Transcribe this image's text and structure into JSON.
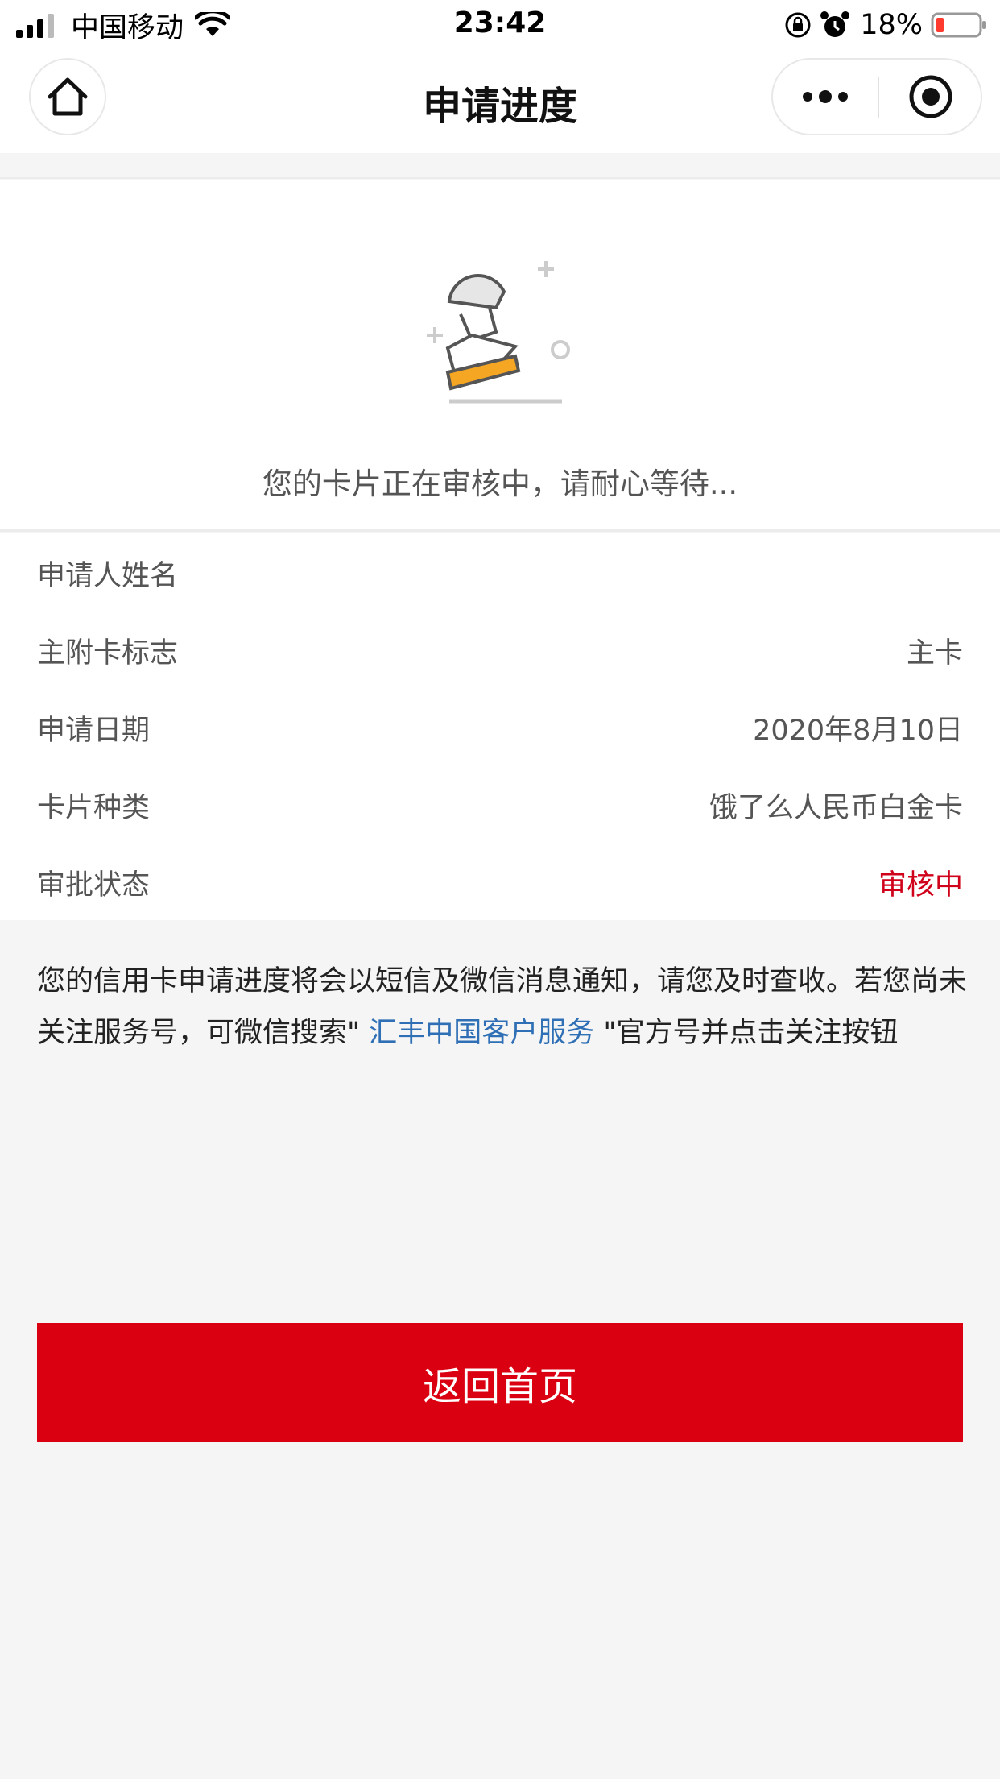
{
  "status_bar": {
    "carrier": "中国移动",
    "time": "23:42",
    "battery": "18%"
  },
  "nav": {
    "title": "申请进度",
    "home_icon": "home-icon",
    "more_icon": "more-dots-icon",
    "close_icon": "target-close-icon"
  },
  "status_card": {
    "icon": "stamp-icon",
    "message": "您的卡片正在审核中，请耐心等待..."
  },
  "info_rows": [
    {
      "label": "申请人姓名",
      "value": ""
    },
    {
      "label": "主附卡标志",
      "value": "主卡"
    },
    {
      "label": "申请日期",
      "value": "2020年8月10日"
    },
    {
      "label": "卡片种类",
      "value": "饿了么人民币白金卡"
    },
    {
      "label": "审批状态",
      "value": "审核中"
    }
  ],
  "notice": {
    "text_before": "您的信用卡申请进度将会以短信及微信消息通知，请您及时查收。若您尚未关注服务号，可微信搜索\" ",
    "link_text": "汇丰中国客户服务",
    "text_after": " \"官方号并点击关注按钮"
  },
  "actions": {
    "home_button_label": "返回首页"
  },
  "colors": {
    "primary_red": "#db0011",
    "status_red": "#d0021b",
    "link_blue": "#2f6fb5",
    "stamp_orange": "#f5a623"
  }
}
